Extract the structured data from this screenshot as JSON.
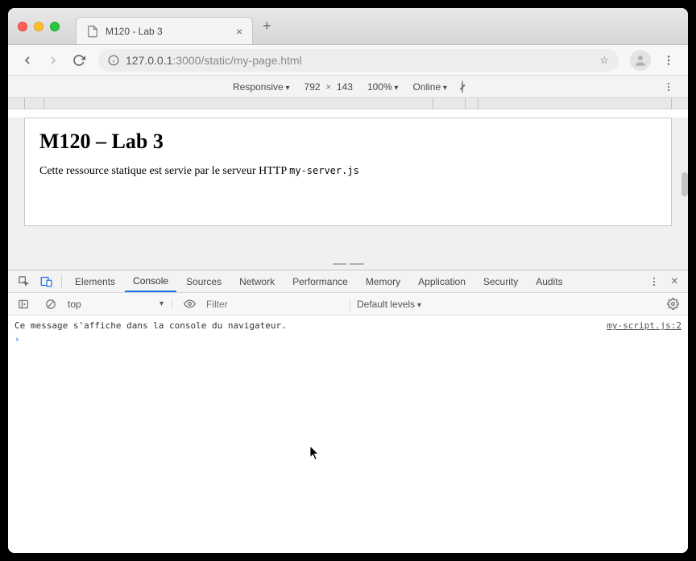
{
  "tab": {
    "title": "M120 - Lab 3"
  },
  "address": {
    "host": "127.0.0.1",
    "port": ":3000",
    "path": "/static/my-page.html"
  },
  "device_bar": {
    "device": "Responsive",
    "width": "792",
    "height": "143",
    "zoom": "100%",
    "network": "Online"
  },
  "page": {
    "heading": "M120 – Lab 3",
    "paragraph_prefix": "Cette ressource statique est servie par le serveur HTTP ",
    "code": "my-server.js"
  },
  "devtools": {
    "tabs": {
      "elements": "Elements",
      "console": "Console",
      "sources": "Sources",
      "network": "Network",
      "performance": "Performance",
      "memory": "Memory",
      "application": "Application",
      "security": "Security",
      "audits": "Audits"
    },
    "console_bar": {
      "context": "top",
      "filter_placeholder": "Filter",
      "levels": "Default levels"
    },
    "console": {
      "message": "Ce message s'affiche dans la console du navigateur.",
      "source": "my-script.js:2"
    }
  }
}
